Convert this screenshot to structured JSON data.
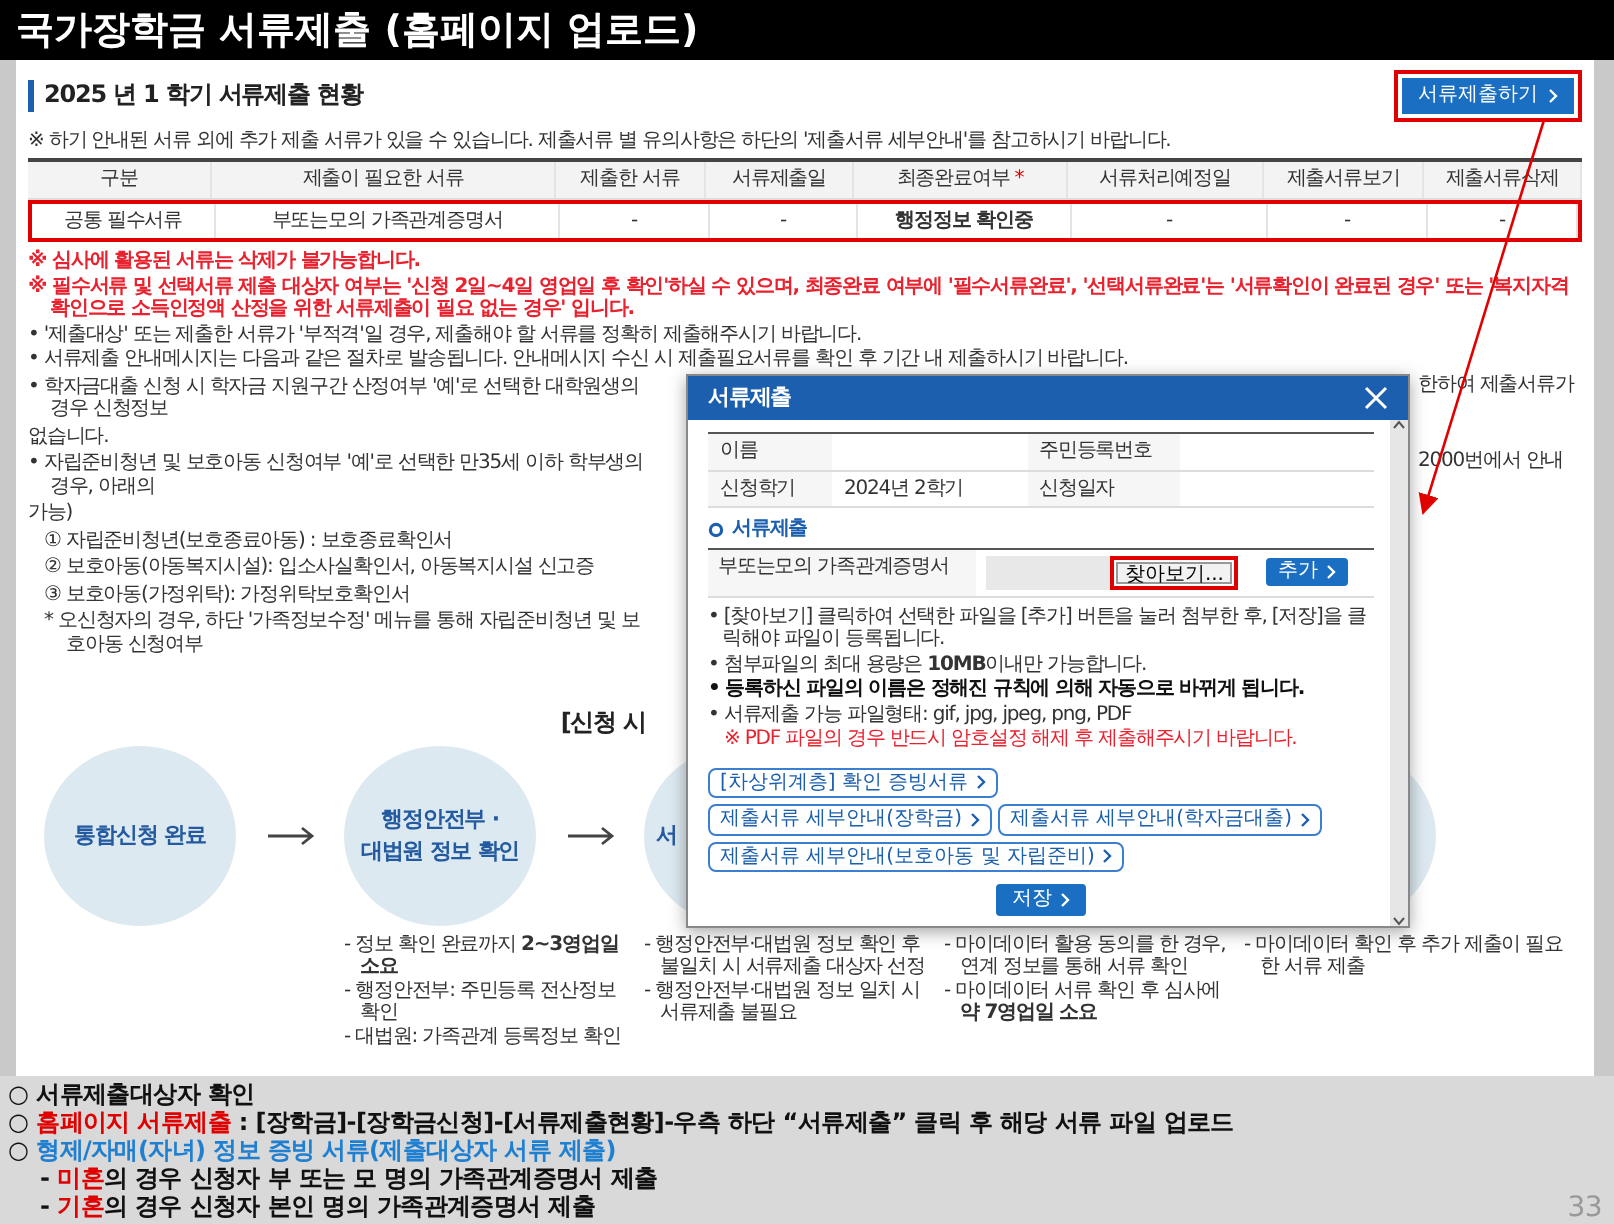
{
  "slide": {
    "title": "국가장학금 서류제출 (홈페이지 업로드)",
    "page_number": "33"
  },
  "status": {
    "heading": "2025 년 1 학기 서류제출 현황",
    "submit_button": {
      "label": "서류제출하기",
      "highlighted": true
    },
    "note": "※ 하기 안내된 서류 외에 추가 제출 서류가 있을 수 있습니다. 제출서류 별 유의사항은 하단의 '제출서류 세부안내'를 참고하시기 바랍니다."
  },
  "table": {
    "columns": [
      {
        "label": "구분"
      },
      {
        "label": "제출이 필요한 서류"
      },
      {
        "label": "제출한 서류"
      },
      {
        "label": "서류제출일"
      },
      {
        "label": "최종완료여부",
        "mark": "*"
      },
      {
        "label": "서류처리예정일"
      },
      {
        "label": "제출서류보기"
      },
      {
        "label": "제출서류삭제"
      }
    ],
    "rows": [
      {
        "highlighted": true,
        "cells": [
          {
            "text": "공통 필수서류"
          },
          {
            "text": "부또는모의 가족관계증명서"
          },
          {
            "text": "-"
          },
          {
            "text": "-"
          },
          {
            "text": "행정정보 확인중",
            "bold": true
          },
          {
            "text": "-"
          },
          {
            "text": "-"
          },
          {
            "text": "-"
          }
        ]
      }
    ]
  },
  "notices": [
    {
      "kind": "warning",
      "marker": "※",
      "text": "심사에 활용된 서류는 삭제가 불가능합니다."
    },
    {
      "kind": "warning",
      "marker": "※",
      "text": "필수서류 및 선택서류 제출 대상자 여부는 '신청 2일~4일 영업일 후 확인'하실 수 있으며, 최종완료 여부에 '필수서류완료', '선택서류완료'는 '서류확인이 완료된 경우' 또는 '복지자격 확인으로 소득인정액 산정을 위한 서류제출이 필요 없는 경우' 입니다."
    },
    {
      "kind": "bullet",
      "marker": "•",
      "text": "'제출대상' 또는 제출한 서류가 '부적격'일 경우, 제출해야 할 서류를 정확히 제출해주시기 바랍니다."
    },
    {
      "kind": "bullet",
      "marker": "•",
      "text": "서류제출 안내메시지는 다음과 같은 절차로 발송됩니다. 안내메시지 수신 시 제출필요서류를 확인 후 기간 내 제출하시기 바랍니다."
    }
  ],
  "covered_lines": [
    {
      "kind": "bullet",
      "marker": "•",
      "left": "학자금대출 신청 시 학자금 지원구간 산정여부 '예'로 선택한 대학원생의 경우 신청정보",
      "right": "한하여 제출서류가"
    },
    {
      "kind": "continuation",
      "left": "없습니다."
    },
    {
      "kind": "bullet",
      "marker": "•",
      "left": "자립준비청년 및 보호아동 신청여부 '예'로 선택한 만35세 이하 학부생의 경우, 아래의",
      "right": "2000번에서 안내"
    },
    {
      "kind": "continuation",
      "left": "가능)"
    },
    {
      "kind": "numbered",
      "marker": "①",
      "left": "자립준비청년(보호종료아동) : 보호종료확인서"
    },
    {
      "kind": "numbered",
      "marker": "②",
      "left": "보호아동(아동복지시설): 입소사실확인서, 아동복지시설 신고증"
    },
    {
      "kind": "numbered",
      "marker": "③",
      "left": "보호아동(가정위탁): 가정위탁보호확인서"
    },
    {
      "kind": "footnote",
      "marker": "*",
      "left": "오신청자의 경우, 하단 '가족정보수정' 메뉴를 통해 자립준비청년 및 보호아동 신청여부"
    }
  ],
  "process": {
    "heading": "[신청 시",
    "steps": [
      {
        "lines": [
          "통합신청 완료"
        ]
      },
      {
        "lines": [
          "행정안전부 ·",
          "대법원 정보 확인"
        ],
        "details": [
          "- 정보 확인 완료까지 **2~3영업일 소요**",
          "- 행정안전부: 주민등록 전산정보 확인",
          "- 대법원: 가족관계 등록정보 확인"
        ]
      },
      {
        "lines": [
          "서"
        ],
        "clipped": true,
        "details": [
          "- 행정안전부·대법원 정보 확인 후 불일치 시 서류제출 대상자 선정",
          "- 행정안전부·대법원 정보 일치 시 서류제출 불필요"
        ]
      },
      {
        "details": [
          "- 마이데이터 활용 동의를 한 경우, 연계 정보를 통해 서류 확인",
          "- 마이데이터 서류 확인 후 심사에 **약 7영업일 소요**"
        ]
      },
      {
        "details": [
          "- 마이데이터 확인 후 추가 제출이 필요한 서류 제출"
        ]
      }
    ]
  },
  "dialog": {
    "title": "서류제출",
    "info_rows": [
      {
        "cells": [
          {
            "label": "이름"
          },
          {
            "label": "주민등록번호"
          }
        ]
      },
      {
        "cells": [
          {
            "label": "신청학기",
            "value": "2024년 2학기"
          },
          {
            "label": "신청일자"
          }
        ]
      }
    ],
    "section": "서류제출",
    "upload": {
      "document": "부또는모의 가족관계증명서",
      "browse_button": {
        "label": "찾아보기...",
        "highlighted": true
      },
      "add_button": "추가"
    },
    "notes": [
      {
        "kind": "plain",
        "text": "• [찾아보기] 클릭하여 선택한 파일을 [추가] 버튼을 눌러 첨부한 후, [저장]을 클릭해야 파일이 등록됩니다."
      },
      {
        "kind": "plain",
        "text": "• 첨부파일의 최대 용량은 **10MB**이내만 가능합니다."
      },
      {
        "kind": "strong",
        "text": "• 등록하신 파일의 이름은 정해진 규칙에 의해 자동으로 바뀌게 됩니다."
      },
      {
        "kind": "plain",
        "text": "• 서류제출 가능 파일형태: gif, jpg, jpeg, png, PDF"
      },
      {
        "kind": "alert",
        "text": "※ PDF 파일의 경우 반드시 암호설정 해제 후 제출해주시기 바랍니다."
      }
    ],
    "link_rows": [
      {
        "links": [
          "[차상위계층] 확인 증빙서류"
        ]
      },
      {
        "links": [
          "제출서류 세부안내(장학금)",
          "제출서류 세부안내(학자금대출)",
          "제출서류 세부안내(보호아동 및 자립준비)"
        ]
      }
    ],
    "save_button": "저장"
  },
  "summary": [
    {
      "kind": "main",
      "marker": "○",
      "segments": [
        {
          "text": "서류제출대상자 확인"
        }
      ]
    },
    {
      "kind": "main",
      "marker": "○",
      "segments": [
        {
          "text": "홈페이지 서류제출",
          "color": "#e00000"
        },
        {
          "text": " : [장학금]-[장학금신청]-[서류제출현황]-우측 하단 “서류제출” 클릭 후 해당 서류 파일 업로드"
        }
      ]
    },
    {
      "kind": "main",
      "marker": "○",
      "segments": [
        {
          "text": "형제/자매(자녀) 정보 증빙 서류(제출대상자 서류 제출)",
          "color": "#1f7fd1"
        }
      ]
    },
    {
      "kind": "sub",
      "marker": "-",
      "segments": [
        {
          "text": "미혼",
          "color": "#e00000"
        },
        {
          "text": "의 경우 신청자 부 또는 모 명의 가족관계증명서 제출"
        }
      ]
    },
    {
      "kind": "sub",
      "marker": "-",
      "segments": [
        {
          "text": "기혼",
          "color": "#e00000"
        },
        {
          "text": "의 경우 신청자 본인 명의 가족관계증명서 제출"
        }
      ]
    }
  ]
}
